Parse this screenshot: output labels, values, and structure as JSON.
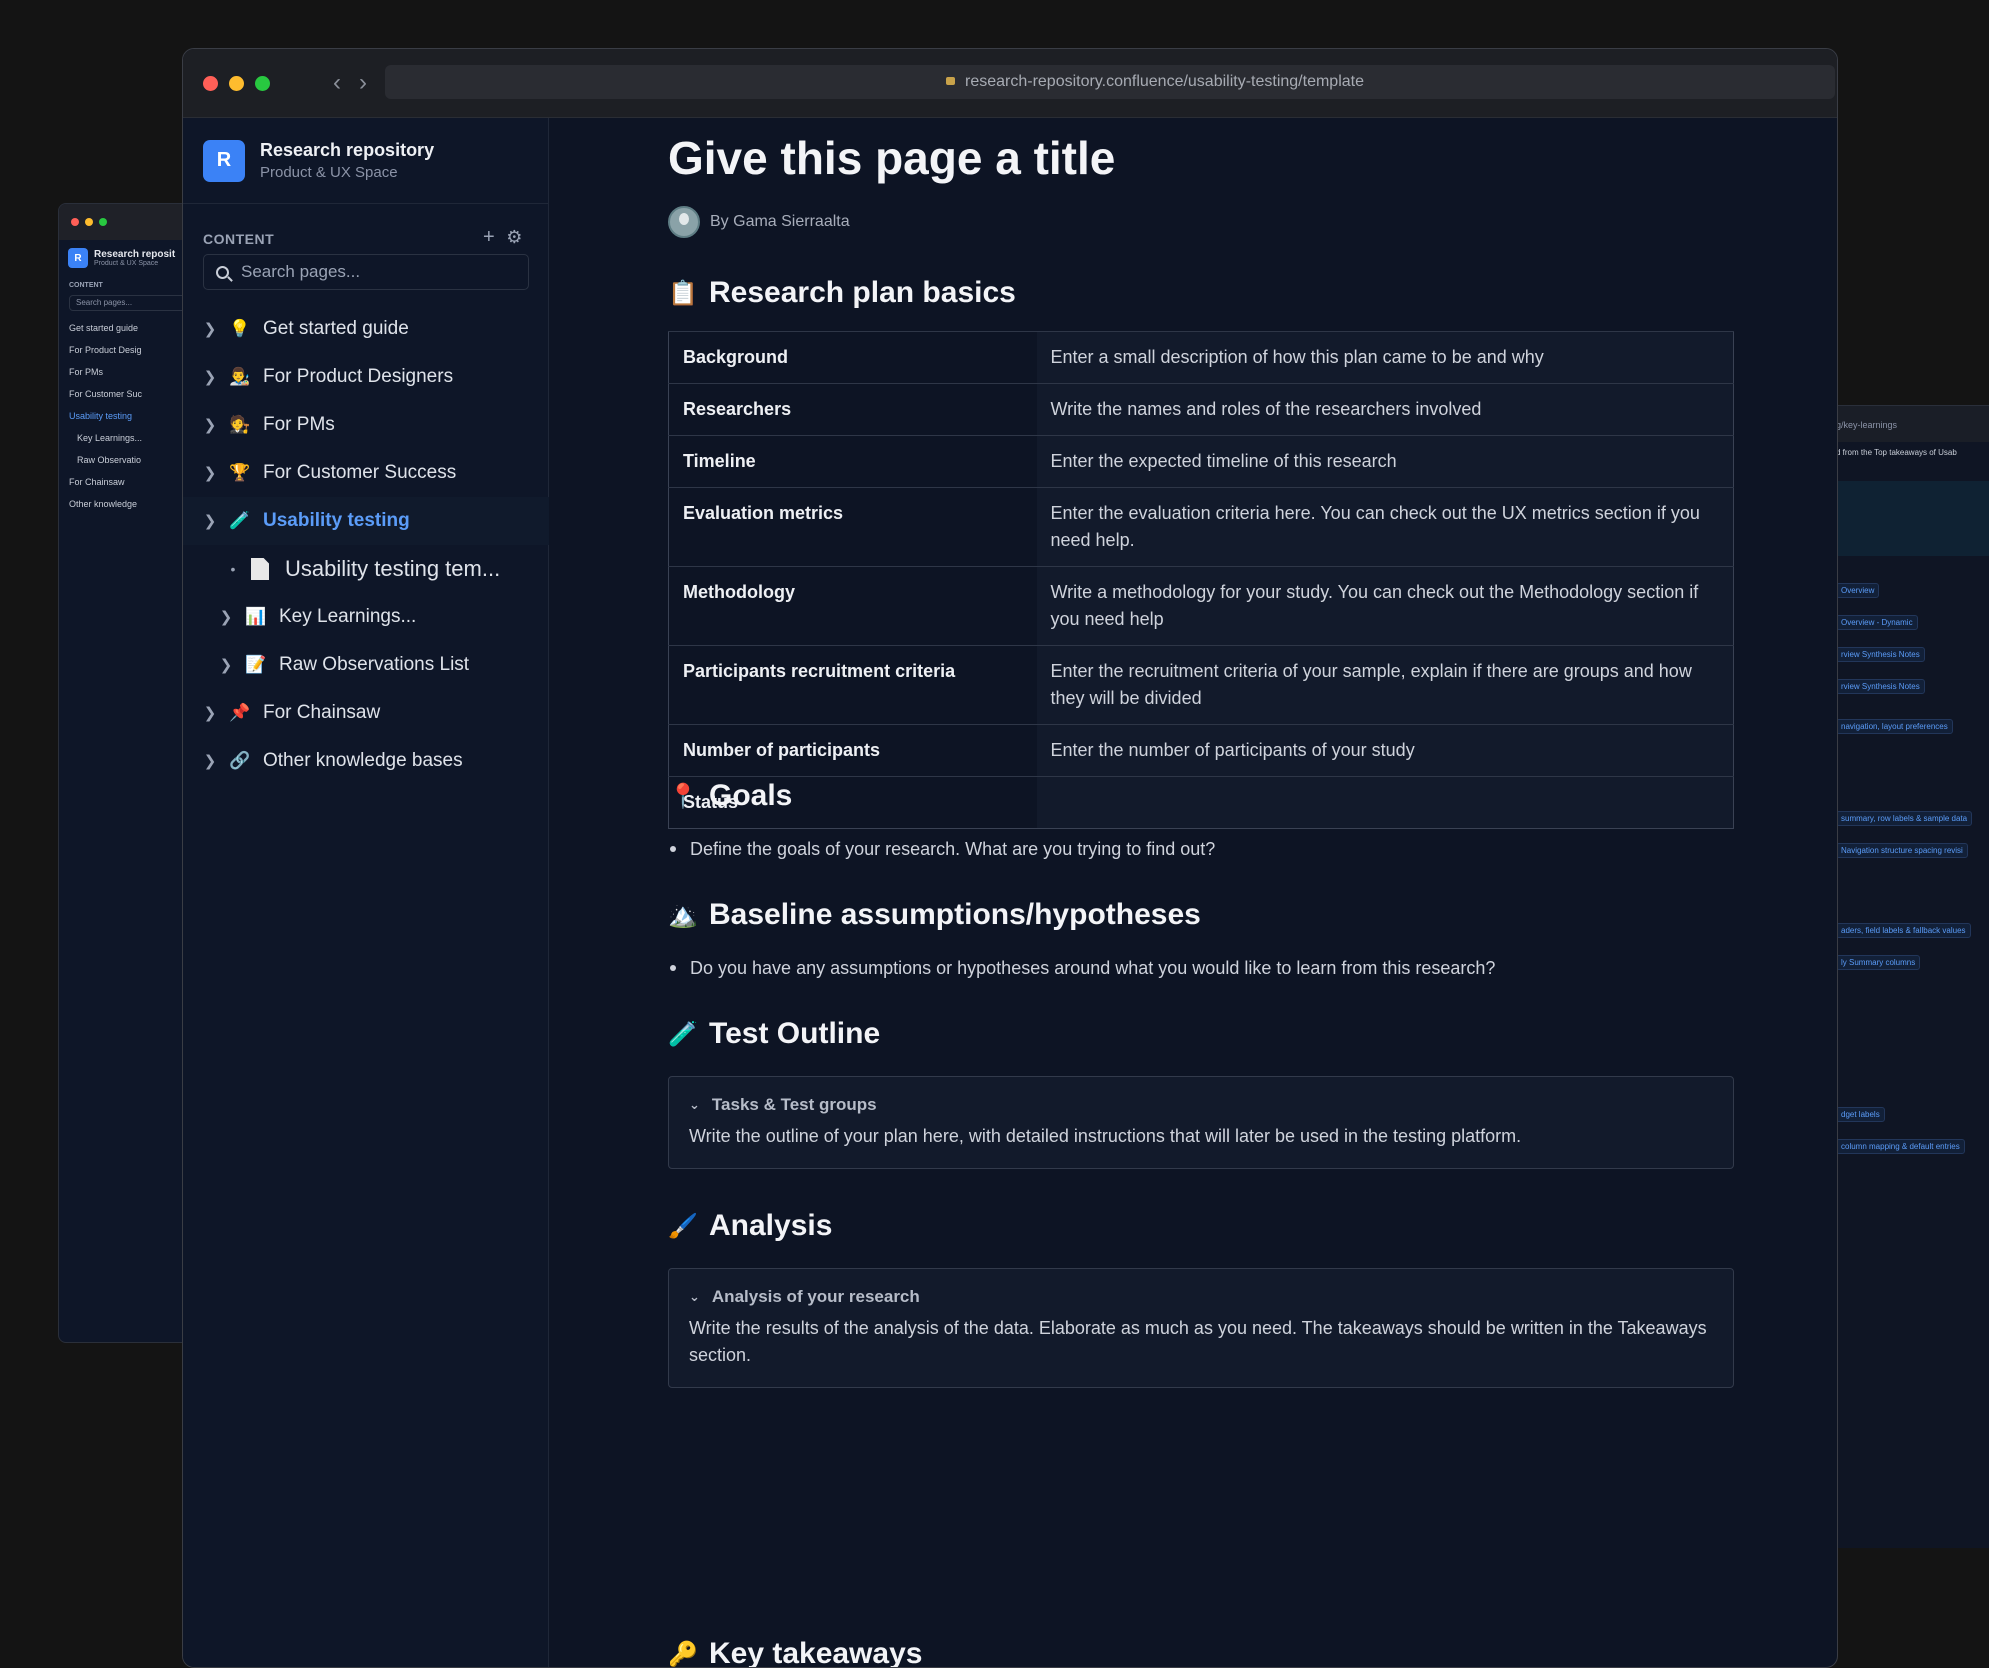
{
  "browser": {
    "url": "research-repository.confluence/usability-testing/template"
  },
  "sidebar": {
    "space_title": "Research repository",
    "space_subtitle": "Product & UX Space",
    "logo_letter": "R",
    "content_label": "CONTENT",
    "search_placeholder": "Search pages...",
    "items": [
      {
        "emoji": "💡",
        "label": "Get started guide"
      },
      {
        "emoji": "👨‍🎨",
        "label": "For Product Designers"
      },
      {
        "emoji": "🧑‍⚖️",
        "label": "For PMs"
      },
      {
        "emoji": "🏆",
        "label": "For Customer Success"
      },
      {
        "emoji": "🧪",
        "label": "Usability testing"
      },
      {
        "emoji": "",
        "label": "Usability testing tem..."
      },
      {
        "emoji": "📊",
        "label": "Key Learnings..."
      },
      {
        "emoji": "📝",
        "label": "Raw Observations List"
      },
      {
        "emoji": "📌",
        "label": "For Chainsaw"
      },
      {
        "emoji": "🔗",
        "label": "Other knowledge bases"
      }
    ]
  },
  "back_window": {
    "items": [
      "Get started guide",
      "For Product Desig",
      "For PMs",
      "For Customer Suc",
      "Usability testing",
      "Key Learnings...",
      "Raw Observatio",
      "For Chainsaw",
      "Other knowledge"
    ],
    "space_title": "Research reposit",
    "space_subtitle": "Product & UX Space",
    "content_label": "CONTENT",
    "search": "Search pages...",
    "logo_letter": "R"
  },
  "right_window": {
    "url": "g/key-learnings",
    "row": "d from the Top takeaways of Usab",
    "tags": [
      "Overview",
      "Overview - Dynamic",
      "rview Synthesis Notes",
      "rview Synthesis Notes",
      "navigation, layout preferences",
      "summary, row labels & sample data",
      "Navigation structure spacing revisi",
      "aders, field labels & fallback values",
      "ly Summary columns",
      "dget labels",
      "column mapping & default entries"
    ]
  },
  "page": {
    "title": "Give this page a title",
    "author": "By Gama Sierraalta",
    "plan_heading": "Research plan basics",
    "plan_emoji": "📋",
    "rows": [
      {
        "k": "Background",
        "v": "Enter a small description of how this plan came to be and why"
      },
      {
        "k": "Researchers",
        "v": "Write the names and roles of the researchers involved"
      },
      {
        "k": "Timeline",
        "v": "Enter the expected timeline of this research"
      },
      {
        "k": "Evaluation metrics",
        "v": "Enter the evaluation criteria here. You can check out the UX metrics section if you need help."
      },
      {
        "k": "Methodology",
        "v": "Write a methodology for your study. You can check out the Methodology section if you need help"
      },
      {
        "k": "Participants recruitment criteria",
        "v": "Enter the recruitment criteria of your sample, explain if there are groups and how they will be divided"
      },
      {
        "k": "Number of participants",
        "v": "Enter the number of participants of your study"
      },
      {
        "k": "Status",
        "v": ""
      }
    ],
    "goals_heading": "Goals",
    "goals_emoji": "📍",
    "goals_bullet": "Define the goals of your research. What are you trying to find out?",
    "assump_heading": "Baseline assumptions/hypotheses",
    "assump_emoji": "🏔️",
    "assump_bullet": "Do you have any assumptions or hypotheses around what you would like to learn from this research?",
    "test_heading": "Test Outline",
    "test_emoji": "🧪",
    "test_box_title": "Tasks & Test groups",
    "test_box_body": "Write the outline of your plan here, with detailed instructions that will later be used in the testing platform.",
    "analysis_heading": "Analysis",
    "analysis_emoji": "🖌️",
    "analysis_box_title": "Analysis of your research",
    "analysis_box_body": "Write the results of the analysis of the data. Elaborate as much as you need. The takeaways should be written in the Takeaways section.",
    "takeaways_heading": "Key takeaways"
  }
}
